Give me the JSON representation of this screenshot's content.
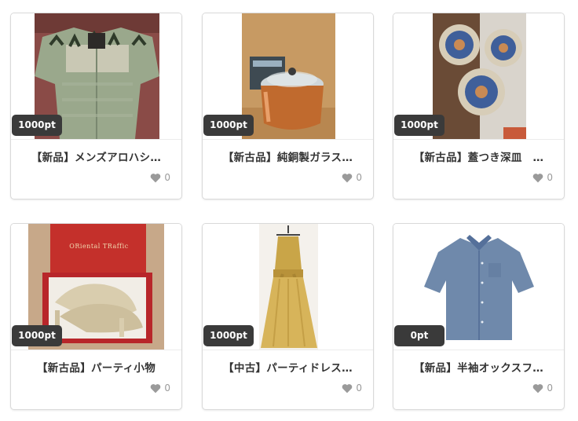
{
  "products": [
    {
      "title": "【新品】メンズアロハシ…",
      "points": "1000pt",
      "likes": "0"
    },
    {
      "title": "【新古品】純銅製ガラス…",
      "points": "1000pt",
      "likes": "0"
    },
    {
      "title": "【新古品】蓋つき深皿　…",
      "points": "1000pt",
      "likes": "0"
    },
    {
      "title": "【新古品】パーティ小物",
      "points": "1000pt",
      "likes": "0",
      "box_text": "ORiental TRaffic"
    },
    {
      "title": "【中古】パーティドレス…",
      "points": "1000pt",
      "likes": "0"
    },
    {
      "title": "【新品】半袖オックスフ…",
      "points": "0pt",
      "likes": "0"
    }
  ],
  "colors": {
    "badge_bg": "#3a3a3a",
    "heart": "#9a9a9a",
    "border": "#d9d9d9"
  },
  "icons": {
    "like": "heart-icon"
  }
}
